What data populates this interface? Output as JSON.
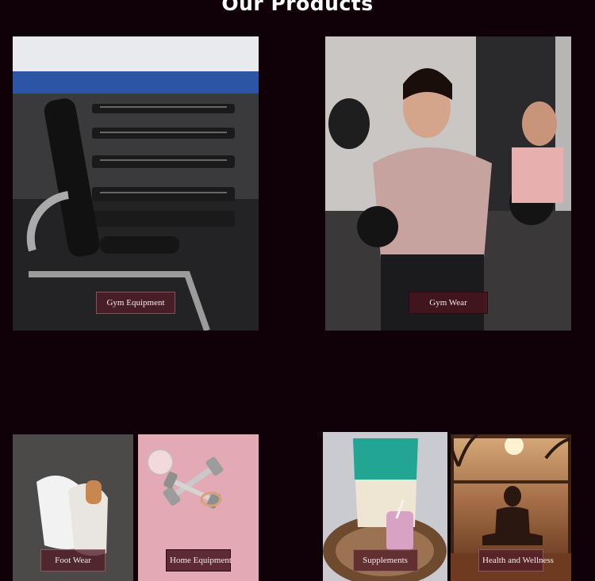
{
  "section": {
    "title": "Our Products"
  },
  "products": [
    {
      "label": "Gym Equipment"
    },
    {
      "label": "Gym Wear"
    },
    {
      "label": "Foot Wear"
    },
    {
      "label": "Home Equipment"
    },
    {
      "label": "Supplements"
    },
    {
      "label": "Health and Wellness"
    }
  ]
}
